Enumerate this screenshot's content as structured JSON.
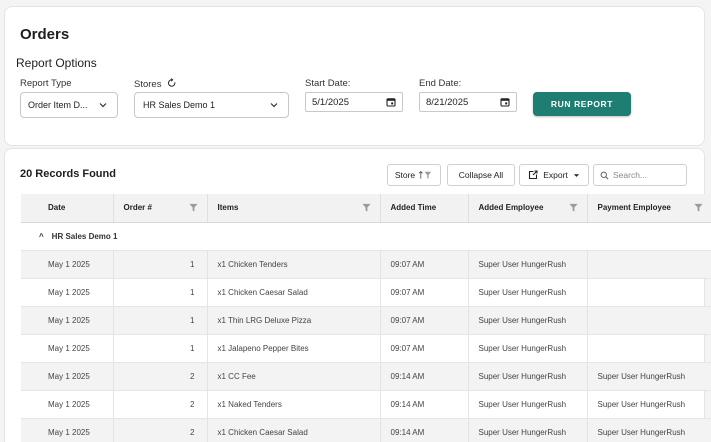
{
  "header": {
    "title": "Orders",
    "report_options": "Report Options"
  },
  "filters": {
    "report_type_label": "Report Type",
    "report_type_value": "Order Item D...",
    "stores_label": "Stores",
    "stores_value": "HR Sales Demo 1",
    "start_label": "Start Date:",
    "start_value": "5/1/2025",
    "end_label": "End Date:",
    "end_value": "8/21/2025",
    "run_label": "RUN REPORT"
  },
  "toolbar": {
    "records": "20 Records Found",
    "store_btn": "Store",
    "collapse_btn": "Collapse All",
    "export_btn": "Export",
    "search_placeholder": "Search..."
  },
  "table": {
    "columns": [
      "Date",
      "Order #",
      "Items",
      "Added Time",
      "Added Employee",
      "Payment Employee"
    ],
    "group": "HR Sales Demo 1",
    "rows": [
      {
        "date": "May 1 2025",
        "order": "1",
        "item": "x1 Chicken Tenders",
        "time": "09:07 AM",
        "added": "Super User HungerRush",
        "payment": ""
      },
      {
        "date": "May 1 2025",
        "order": "1",
        "item": "x1 Chicken Caesar Salad",
        "time": "09:07 AM",
        "added": "Super User HungerRush",
        "payment": ""
      },
      {
        "date": "May 1 2025",
        "order": "1",
        "item": "x1 Thin LRG Deluxe Pizza",
        "time": "09:07 AM",
        "added": "Super User HungerRush",
        "payment": ""
      },
      {
        "date": "May 1 2025",
        "order": "1",
        "item": "x1 Jalapeno Pepper Bites",
        "time": "09:07 AM",
        "added": "Super User HungerRush",
        "payment": ""
      },
      {
        "date": "May 1 2025",
        "order": "2",
        "item": "x1 CC Fee",
        "time": "09:14 AM",
        "added": "Super User HungerRush",
        "payment": "Super User HungerRush"
      },
      {
        "date": "May 1 2025",
        "order": "2",
        "item": "x1 Naked Tenders",
        "time": "09:14 AM",
        "added": "Super User HungerRush",
        "payment": "Super User HungerRush"
      },
      {
        "date": "May 1 2025",
        "order": "2",
        "item": "x1 Chicken Caesar Salad",
        "time": "09:14 AM",
        "added": "Super User HungerRush",
        "payment": "Super User HungerRush"
      }
    ]
  },
  "colors": {
    "accent": "#1e7e72"
  }
}
